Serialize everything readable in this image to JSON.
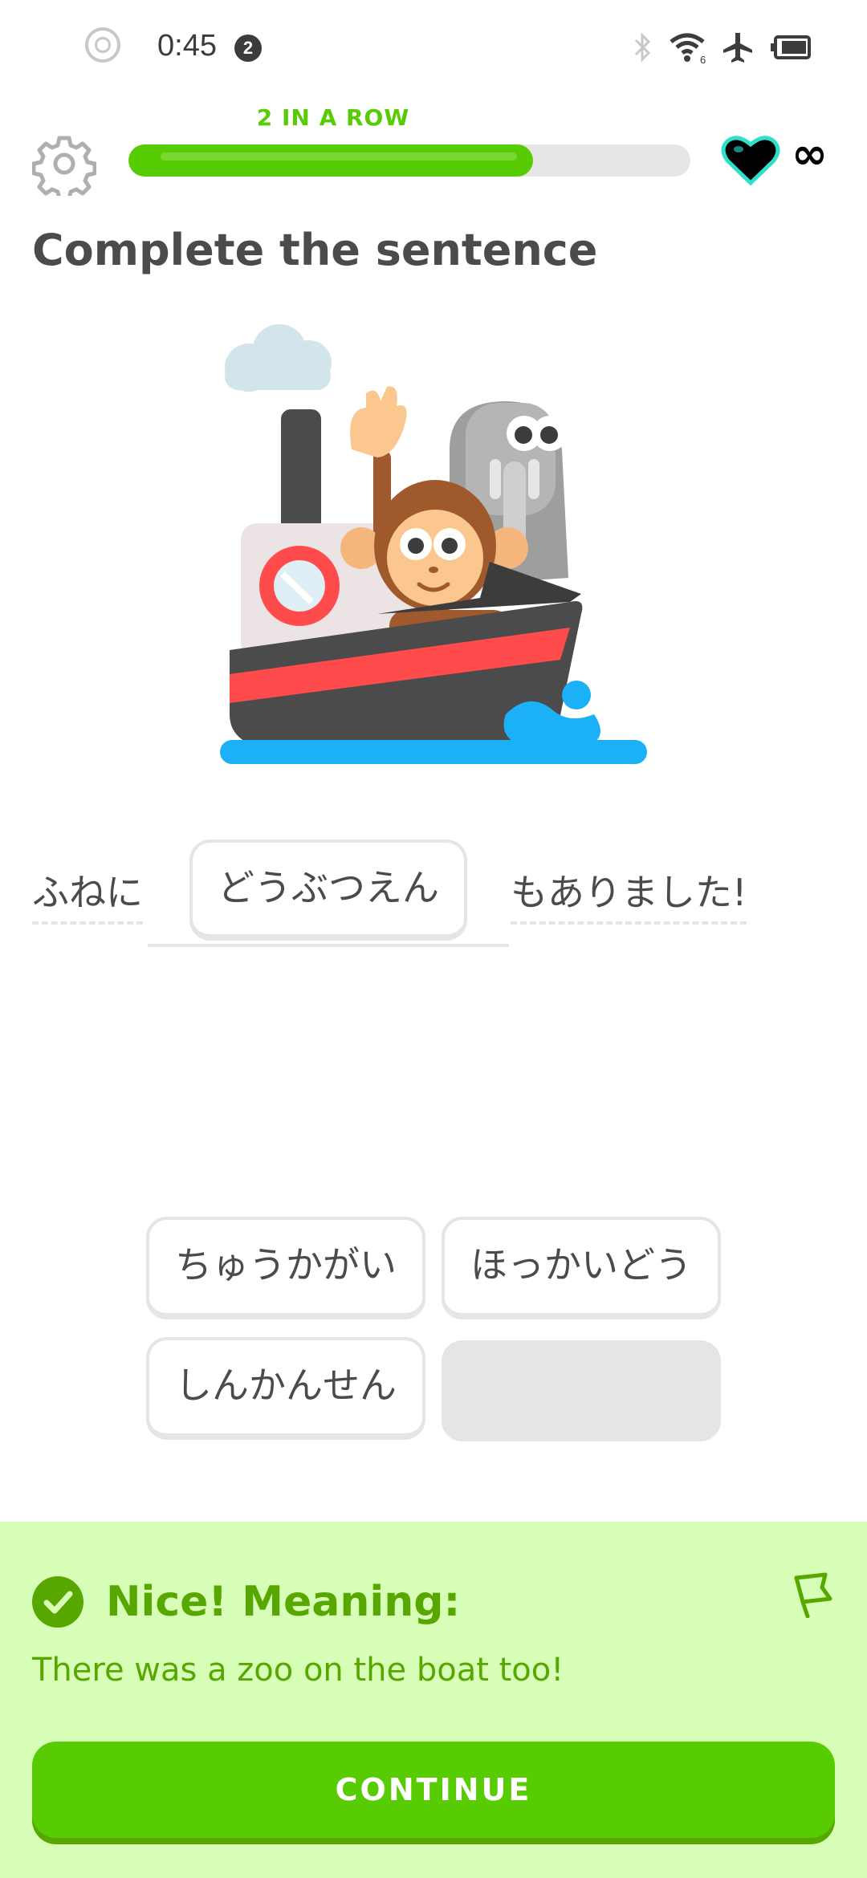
{
  "status_bar": {
    "time": "0:45",
    "notification_count": "2",
    "wifi_sub": "6"
  },
  "header": {
    "streak_label": "2 IN A ROW",
    "progress": 0.72,
    "hearts": "∞"
  },
  "challenge": {
    "title": "Complete the sentence",
    "before": "ふねに",
    "answer": "どうぶつえん",
    "after": "もありました!"
  },
  "word_bank": [
    "ちゅうかがい",
    "ほっかいどう",
    "しんかんせん"
  ],
  "feedback": {
    "title": "Nice! Meaning:",
    "meaning": "There was a zoo on the boat too!",
    "continue_label": "CONTINUE"
  },
  "colors": {
    "accent": "#58cc02",
    "accent_dark": "#58a700",
    "feedback_bg": "#d7ffb8"
  }
}
